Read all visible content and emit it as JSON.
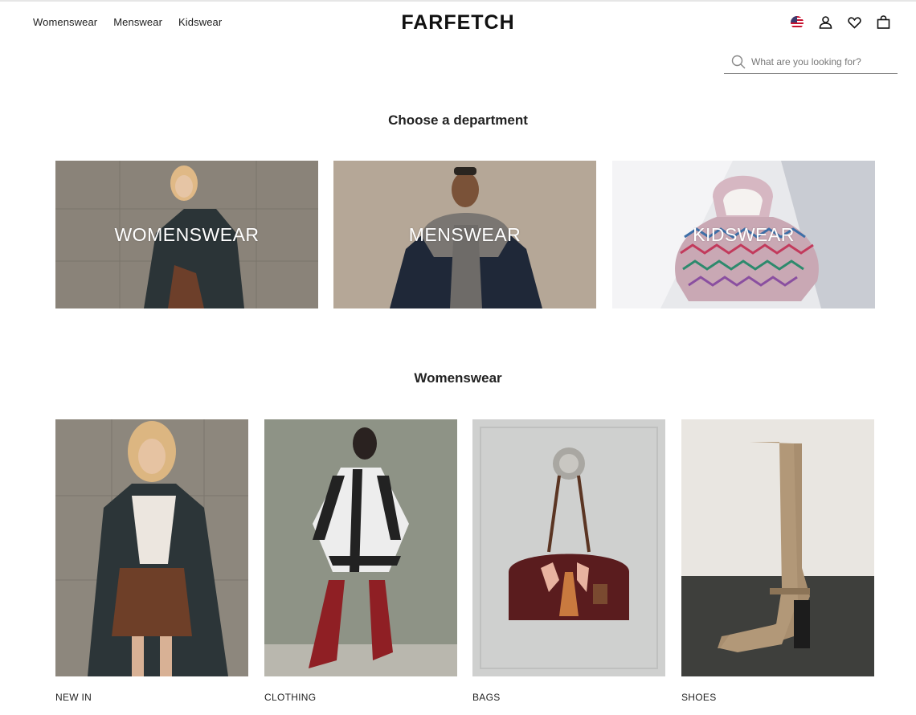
{
  "header": {
    "logo": "FARFETCH",
    "nav": [
      "Womenswear",
      "Menswear",
      "Kidswear"
    ],
    "icons": [
      "us-flag-icon",
      "account-icon",
      "wishlist-heart-icon",
      "shopping-bag-icon"
    ]
  },
  "search": {
    "placeholder": "What are you looking for?",
    "value": ""
  },
  "departments": {
    "title": "Choose a department",
    "tiles": [
      {
        "label": "WOMENSWEAR"
      },
      {
        "label": "MENSWEAR"
      },
      {
        "label": "KIDSWEAR"
      }
    ]
  },
  "womenswear": {
    "title": "Womenswear",
    "categories": [
      {
        "label": "NEW IN"
      },
      {
        "label": "CLOTHING"
      },
      {
        "label": "BAGS"
      },
      {
        "label": "SHOES"
      }
    ]
  },
  "colors": {
    "text": "#222222",
    "divider": "#8a8a8a",
    "tile_text": "#ffffff"
  }
}
